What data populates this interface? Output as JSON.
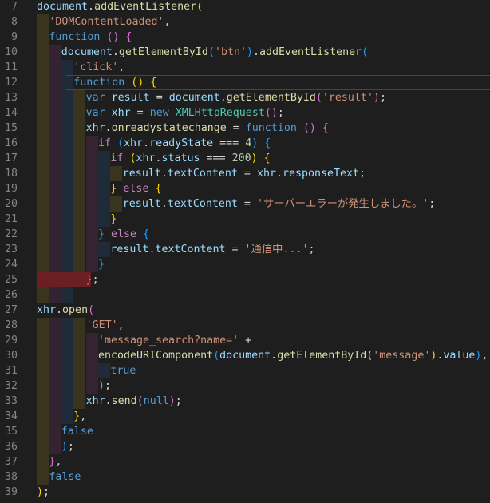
{
  "editor": {
    "lines": [
      {
        "n": "7",
        "t": [
          [
            "document",
            "var"
          ],
          [
            ".",
            "p"
          ],
          [
            "addEventListener",
            "fn"
          ],
          [
            "(",
            "b1"
          ]
        ]
      },
      {
        "n": "8",
        "t": [
          [
            "'DOMContentLoaded'",
            "str"
          ],
          [
            ",",
            "p"
          ]
        ]
      },
      {
        "n": "9",
        "t": [
          [
            "function",
            "kw"
          ],
          [
            " ",
            "p"
          ],
          [
            "()",
            "b2"
          ],
          [
            " ",
            "p"
          ],
          [
            "{",
            "b2"
          ]
        ]
      },
      {
        "n": "10",
        "t": [
          [
            "document",
            "var"
          ],
          [
            ".",
            "p"
          ],
          [
            "getElementById",
            "fn"
          ],
          [
            "(",
            "b3"
          ],
          [
            "'btn'",
            "str"
          ],
          [
            ")",
            "b3"
          ],
          [
            ".",
            "p"
          ],
          [
            "addEventListener",
            "fn"
          ],
          [
            "(",
            "b3"
          ]
        ]
      },
      {
        "n": "11",
        "t": [
          [
            "'click'",
            "str"
          ],
          [
            ",",
            "p"
          ]
        ]
      },
      {
        "n": "12",
        "t": [
          [
            "function",
            "kw"
          ],
          [
            " ",
            "p"
          ],
          [
            "()",
            "b1"
          ],
          [
            " ",
            "p"
          ],
          [
            "{",
            "b1"
          ]
        ]
      },
      {
        "n": "13",
        "t": [
          [
            "var",
            "kw"
          ],
          [
            " ",
            "p"
          ],
          [
            "result",
            "var"
          ],
          [
            " = ",
            "p"
          ],
          [
            "document",
            "var"
          ],
          [
            ".",
            "p"
          ],
          [
            "getElementById",
            "fn"
          ],
          [
            "(",
            "b2"
          ],
          [
            "'result'",
            "str"
          ],
          [
            ")",
            "b2"
          ],
          [
            ";",
            "p"
          ]
        ]
      },
      {
        "n": "14",
        "t": [
          [
            "var",
            "kw"
          ],
          [
            " ",
            "p"
          ],
          [
            "xhr",
            "var"
          ],
          [
            " = ",
            "p"
          ],
          [
            "new",
            "kw"
          ],
          [
            " ",
            "p"
          ],
          [
            "XMLHttpRequest",
            "type"
          ],
          [
            "()",
            "b2"
          ],
          [
            ";",
            "p"
          ]
        ]
      },
      {
        "n": "15",
        "t": [
          [
            "xhr",
            "var"
          ],
          [
            ".",
            "p"
          ],
          [
            "onreadystatechange",
            "fn"
          ],
          [
            " = ",
            "p"
          ],
          [
            "function",
            "kw"
          ],
          [
            " ",
            "p"
          ],
          [
            "()",
            "b2"
          ],
          [
            " ",
            "p"
          ],
          [
            "{",
            "b2"
          ]
        ]
      },
      {
        "n": "16",
        "t": [
          [
            "if",
            "ctrl"
          ],
          [
            " ",
            "p"
          ],
          [
            "(",
            "b3"
          ],
          [
            "xhr",
            "var"
          ],
          [
            ".",
            "p"
          ],
          [
            "readyState",
            "var"
          ],
          [
            " === ",
            "p"
          ],
          [
            "4",
            "num"
          ],
          [
            ")",
            "b3"
          ],
          [
            " ",
            "p"
          ],
          [
            "{",
            "b3"
          ]
        ]
      },
      {
        "n": "17",
        "t": [
          [
            "if",
            "ctrl"
          ],
          [
            " ",
            "p"
          ],
          [
            "(",
            "b1"
          ],
          [
            "xhr",
            "var"
          ],
          [
            ".",
            "p"
          ],
          [
            "status",
            "var"
          ],
          [
            " === ",
            "p"
          ],
          [
            "200",
            "num"
          ],
          [
            ")",
            "b1"
          ],
          [
            " ",
            "p"
          ],
          [
            "{",
            "b1"
          ]
        ]
      },
      {
        "n": "18",
        "t": [
          [
            "result",
            "var"
          ],
          [
            ".",
            "p"
          ],
          [
            "textContent",
            "var"
          ],
          [
            " = ",
            "p"
          ],
          [
            "xhr",
            "var"
          ],
          [
            ".",
            "p"
          ],
          [
            "responseText",
            "var"
          ],
          [
            ";",
            "p"
          ]
        ]
      },
      {
        "n": "19",
        "t": [
          [
            "}",
            "b1"
          ],
          [
            " ",
            "p"
          ],
          [
            "else",
            "ctrl"
          ],
          [
            " ",
            "p"
          ],
          [
            "{",
            "b1"
          ]
        ]
      },
      {
        "n": "20",
        "t": [
          [
            "result",
            "var"
          ],
          [
            ".",
            "p"
          ],
          [
            "textContent",
            "var"
          ],
          [
            " = ",
            "p"
          ],
          [
            "'サーバーエラーが発生しました。'",
            "str"
          ],
          [
            ";",
            "p"
          ]
        ]
      },
      {
        "n": "21",
        "t": [
          [
            "}",
            "b1"
          ]
        ]
      },
      {
        "n": "22",
        "t": [
          [
            "}",
            "b3"
          ],
          [
            " ",
            "p"
          ],
          [
            "else",
            "ctrl"
          ],
          [
            " ",
            "p"
          ],
          [
            "{",
            "b3"
          ]
        ]
      },
      {
        "n": "23",
        "t": [
          [
            "result",
            "var"
          ],
          [
            ".",
            "p"
          ],
          [
            "textContent",
            "var"
          ],
          [
            " = ",
            "p"
          ],
          [
            "'通信中...'",
            "str"
          ],
          [
            ";",
            "p"
          ]
        ]
      },
      {
        "n": "24",
        "t": [
          [
            "}",
            "b3"
          ]
        ]
      },
      {
        "n": "25",
        "t": [
          [
            "}",
            "b2"
          ],
          [
            ";",
            "p"
          ]
        ]
      },
      {
        "n": "26",
        "t": []
      },
      {
        "n": "27",
        "t": [
          [
            "xhr",
            "var"
          ],
          [
            ".",
            "p"
          ],
          [
            "open",
            "fn"
          ],
          [
            "(",
            "b2"
          ]
        ]
      },
      {
        "n": "28",
        "t": [
          [
            "'GET'",
            "str"
          ],
          [
            ",",
            "p"
          ]
        ]
      },
      {
        "n": "29",
        "t": [
          [
            "'message_search?name='",
            "str"
          ],
          [
            " +",
            "p"
          ]
        ]
      },
      {
        "n": "30",
        "t": [
          [
            "encodeURIComponent",
            "fn"
          ],
          [
            "(",
            "b3"
          ],
          [
            "document",
            "var"
          ],
          [
            ".",
            "p"
          ],
          [
            "getElementById",
            "fn"
          ],
          [
            "(",
            "b1"
          ],
          [
            "'message'",
            "str"
          ],
          [
            ")",
            "b1"
          ],
          [
            ".",
            "p"
          ],
          [
            "value",
            "var"
          ],
          [
            ")",
            "b3"
          ],
          [
            ",",
            "p"
          ]
        ]
      },
      {
        "n": "31",
        "t": [
          [
            "true",
            "kw"
          ]
        ]
      },
      {
        "n": "32",
        "t": [
          [
            ")",
            "b2"
          ],
          [
            ";",
            "p"
          ]
        ]
      },
      {
        "n": "33",
        "t": [
          [
            "xhr",
            "var"
          ],
          [
            ".",
            "p"
          ],
          [
            "send",
            "fn"
          ],
          [
            "(",
            "b2"
          ],
          [
            "null",
            "kw"
          ],
          [
            ")",
            "b2"
          ],
          [
            ";",
            "p"
          ]
        ]
      },
      {
        "n": "34",
        "t": [
          [
            "}",
            "b1"
          ],
          [
            ",",
            "p"
          ]
        ]
      },
      {
        "n": "35",
        "t": [
          [
            "false",
            "kw"
          ]
        ]
      },
      {
        "n": "36",
        "t": [
          [
            ")",
            "b3"
          ],
          [
            ";",
            "p"
          ]
        ]
      },
      {
        "n": "37",
        "t": [
          [
            "}",
            "b2"
          ],
          [
            ",",
            "p"
          ]
        ]
      },
      {
        "n": "38",
        "t": [
          [
            "false",
            "kw"
          ]
        ]
      },
      {
        "n": "39",
        "t": [
          [
            ")",
            "b1"
          ],
          [
            ";",
            "p"
          ]
        ]
      }
    ]
  },
  "colors": {
    "background": "#1e1e1e",
    "line_number": "#858585",
    "keyword": "#569cd6",
    "string": "#ce9178",
    "function": "#dcdcaa",
    "variable": "#9cdcfe",
    "type": "#4ec9b0",
    "number": "#b5cea8",
    "control": "#c586c0",
    "bracket_yellow": "#ffd700",
    "bracket_purple": "#da70d6",
    "bracket_blue": "#179fff",
    "error_highlight": "#6b1f23"
  }
}
